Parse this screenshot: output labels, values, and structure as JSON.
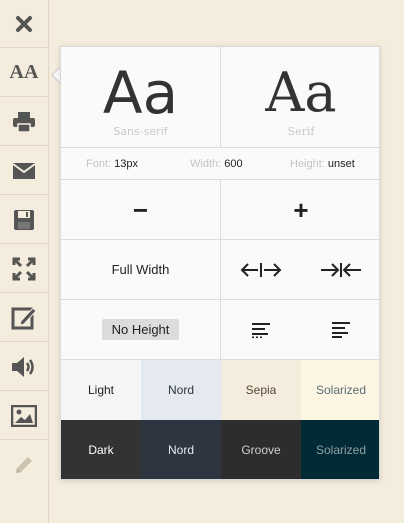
{
  "sidebar": {
    "items": [
      {
        "icon": "close-icon"
      },
      {
        "icon": "font-size-icon",
        "label": "AA"
      },
      {
        "icon": "print-icon"
      },
      {
        "icon": "mail-icon"
      },
      {
        "icon": "save-icon"
      },
      {
        "icon": "fullscreen-icon"
      },
      {
        "icon": "edit-icon"
      },
      {
        "icon": "speaker-icon"
      },
      {
        "icon": "image-icon"
      },
      {
        "icon": "pencil-icon"
      }
    ]
  },
  "panel": {
    "fonts": [
      {
        "sample": "Aa",
        "name": "Sans-serif"
      },
      {
        "sample": "Aa",
        "name": "Serif"
      }
    ],
    "info": {
      "font_label": "Font:",
      "font_value": "13px",
      "width_label": "Width:",
      "width_value": "600",
      "height_label": "Height:",
      "height_value": "unset"
    },
    "size_controls": {
      "decrease": "−",
      "increase": "+"
    },
    "width_controls": {
      "full_width": "Full Width"
    },
    "height_controls": {
      "no_height": "No Height"
    },
    "themes": [
      {
        "label": "Light",
        "bg": "#f5f5f5",
        "fg": "#222222"
      },
      {
        "label": "Nord",
        "bg": "#e5e9f0",
        "fg": "#2e3440"
      },
      {
        "label": "Sepia",
        "bg": "#f4ecdd",
        "fg": "#5b4636"
      },
      {
        "label": "Solarized",
        "bg": "#fdf6e3",
        "fg": "#586e75"
      },
      {
        "label": "Dark",
        "bg": "#333333",
        "fg": "#ffffff"
      },
      {
        "label": "Nord",
        "bg": "#2e3440",
        "fg": "#e5e9f0"
      },
      {
        "label": "Groove",
        "bg": "#2d2d2d",
        "fg": "#d0d0d0"
      },
      {
        "label": "Solarized",
        "bg": "#002b36",
        "fg": "#93a1a1"
      }
    ]
  }
}
